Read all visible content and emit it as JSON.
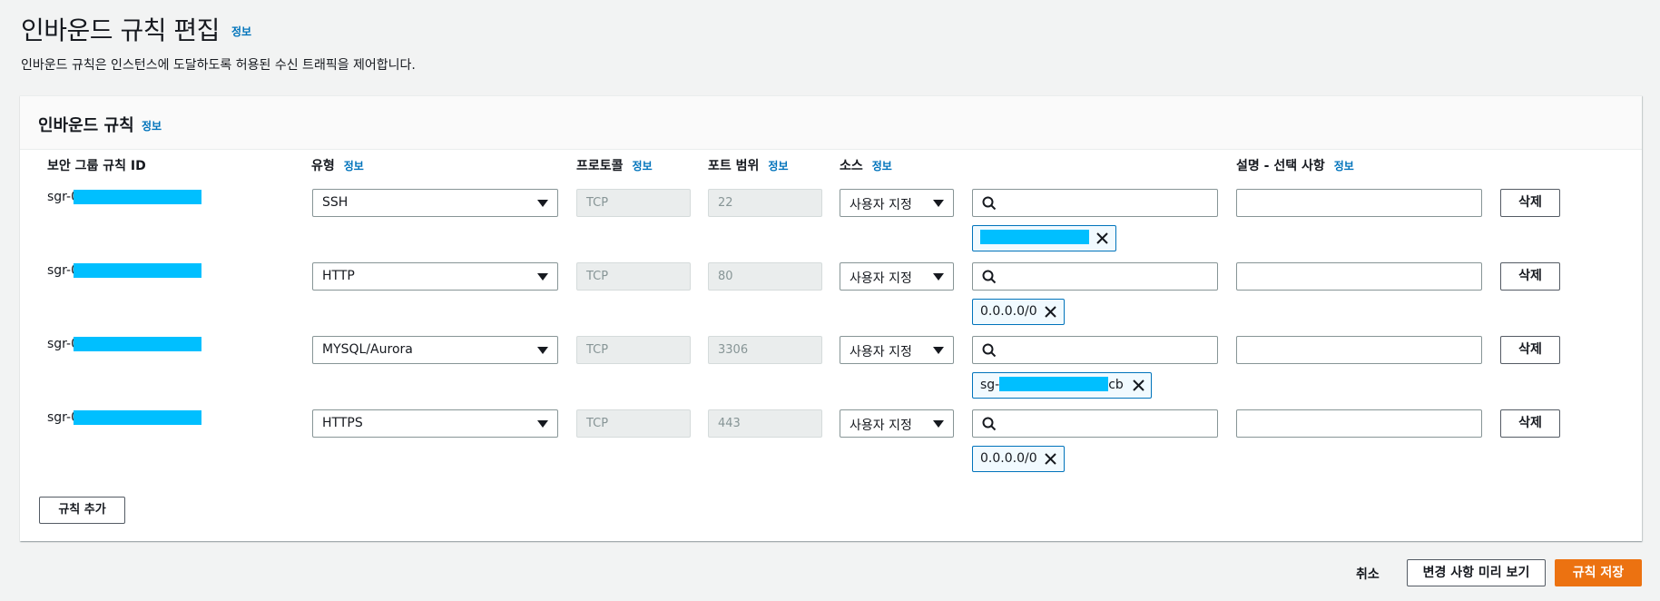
{
  "page": {
    "title": "인바운드 규칙 편집",
    "info": "정보",
    "description": "인바운드 규칙은 인스턴스에 도달하도록 허용된 수신 트래픽을 제어합니다."
  },
  "panel": {
    "title": "인바운드 규칙",
    "info": "정보",
    "columns": {
      "rule_id": "보안 그룹 규칙 ID",
      "type": "유형",
      "type_info": "정보",
      "protocol": "프로토콜",
      "protocol_info": "정보",
      "port_range": "포트 범위",
      "port_info": "정보",
      "source": "소스",
      "source_info": "정보",
      "description": "설명 - 선택 사항",
      "description_info": "정보"
    },
    "rows": [
      {
        "rule_id_prefix": "sgr-0",
        "type": "SSH",
        "protocol": "TCP",
        "port": "22",
        "source_type": "사용자 지정",
        "token_prefix": "",
        "token_suffix": "",
        "delete": "삭제"
      },
      {
        "rule_id_prefix": "sgr-0",
        "type": "HTTP",
        "protocol": "TCP",
        "port": "80",
        "source_type": "사용자 지정",
        "token_prefix": "0.0.0.0/0",
        "token_suffix": "",
        "delete": "삭제"
      },
      {
        "rule_id_prefix": "sgr-0",
        "type": "MYSQL/Aurora",
        "protocol": "TCP",
        "port": "3306",
        "source_type": "사용자 지정",
        "token_prefix": "sg-",
        "token_suffix": "cb",
        "delete": "삭제"
      },
      {
        "rule_id_prefix": "sgr-0",
        "type": "HTTPS",
        "protocol": "TCP",
        "port": "443",
        "source_type": "사용자 지정",
        "token_prefix": "0.0.0.0/0",
        "token_suffix": "",
        "delete": "삭제"
      }
    ],
    "add_rule": "규칙 추가"
  },
  "footer": {
    "cancel": "취소",
    "preview": "변경 사항 미리 보기",
    "save": "규칙 저장"
  },
  "colors": {
    "accent": "#ec7211",
    "link": "#0073bb",
    "redaction": "#00bfff"
  }
}
